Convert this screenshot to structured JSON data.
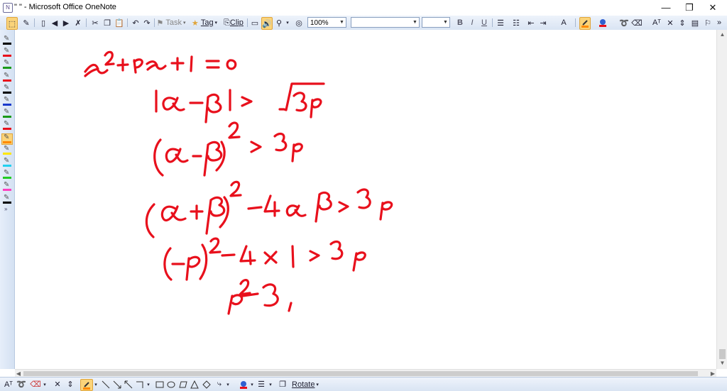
{
  "window": {
    "title": "\" \" - Microsoft Office OneNote",
    "minimize": "—",
    "restore": "❐",
    "close": "✕"
  },
  "toolbar": {
    "task_label": "Task",
    "tag_label": "Tag",
    "clip_label": "Clip",
    "zoom_value": "100%",
    "font_value": "",
    "size_value": "",
    "bold": "B",
    "italic": "I",
    "underline": "U",
    "pen_color": "#ff8a00",
    "highlight_color": "#e8101c"
  },
  "pens": [
    {
      "color": "#000000"
    },
    {
      "color": "#e8101c"
    },
    {
      "color": "#1a9a1a"
    },
    {
      "color": "#e8101c"
    },
    {
      "color": "#000000"
    },
    {
      "color": "#1a3acc"
    },
    {
      "color": "#1a9a1a"
    },
    {
      "color": "#e8101c"
    },
    {
      "color": "#ff8a00",
      "selected": true
    },
    {
      "color": "#ffe600"
    },
    {
      "color": "#22d0f0"
    },
    {
      "color": "#22cc22"
    },
    {
      "color": "#ff40c0"
    },
    {
      "color": "#000000"
    }
  ],
  "bottom_toolbar": {
    "rotate_label": "Rotate"
  },
  "ink_color": "#e8101c"
}
